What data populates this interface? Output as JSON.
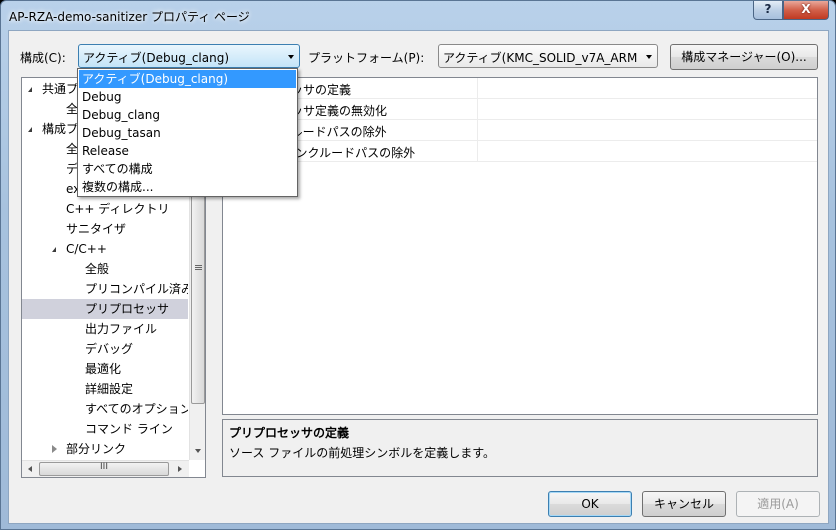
{
  "window": {
    "title": "AP-RZA-demo-sanitizer プロパティ ページ"
  },
  "caption_buttons": {
    "help": "?",
    "close": "X"
  },
  "toolbar": {
    "config_label": "構成(C):",
    "config_value": "アクティブ(Debug_clang)",
    "platform_label": "プラットフォーム(P):",
    "platform_value": "アクティブ(KMC_SOLID_v7A_ARM",
    "config_manager_button": "構成マネージャー(O)..."
  },
  "config_dropdown": {
    "options": [
      "アクティブ(Debug_clang)",
      "Debug",
      "Debug_clang",
      "Debug_tasan",
      "Release",
      "すべての構成",
      "複数の構成..."
    ],
    "highlighted_index": 0
  },
  "tree": {
    "items": [
      {
        "label": "共通プロパティ",
        "level": 0,
        "expanded": true
      },
      {
        "label": "全般",
        "level": 1
      },
      {
        "label": "構成プロパティ",
        "level": 0,
        "expanded": true
      },
      {
        "label": "全般",
        "level": 1
      },
      {
        "label": "デバッグ",
        "level": 1
      },
      {
        "label": "ex",
        "level": 1
      },
      {
        "label": "C++ ディレクトリ",
        "level": 1
      },
      {
        "label": "サニタイザ",
        "level": 1
      },
      {
        "label": "C/C++",
        "level": 1,
        "expanded": true
      },
      {
        "label": "全般",
        "level": 2
      },
      {
        "label": "プリコンパイル済みヘッダー",
        "level": 2
      },
      {
        "label": "プリプロセッサ",
        "level": 2,
        "selected": true
      },
      {
        "label": "出力ファイル",
        "level": 2
      },
      {
        "label": "デバッグ",
        "level": 2
      },
      {
        "label": "最適化",
        "level": 2
      },
      {
        "label": "詳細設定",
        "level": 2
      },
      {
        "label": "すべてのオプション",
        "level": 2
      },
      {
        "label": "コマンド ライン",
        "level": 2
      },
      {
        "label": "部分リンク",
        "level": 1,
        "expanded": false
      }
    ],
    "hscroll_grip": "III"
  },
  "grid": {
    "rows": [
      {
        "name": "プリプロセッサの定義",
        "value": ""
      },
      {
        "name": "プリプロセッサ定義の無効化",
        "value": ""
      },
      {
        "name": "標準インクルードパスの除外",
        "value": ""
      },
      {
        "name": "C++標準インクルードパスの除外",
        "value": ""
      }
    ]
  },
  "description": {
    "title": "プリプロセッサの定義",
    "text": "ソース ファイルの前処理シンボルを定義します。"
  },
  "footer": {
    "ok": "OK",
    "cancel": "キャンセル",
    "apply": "適用(A)"
  }
}
